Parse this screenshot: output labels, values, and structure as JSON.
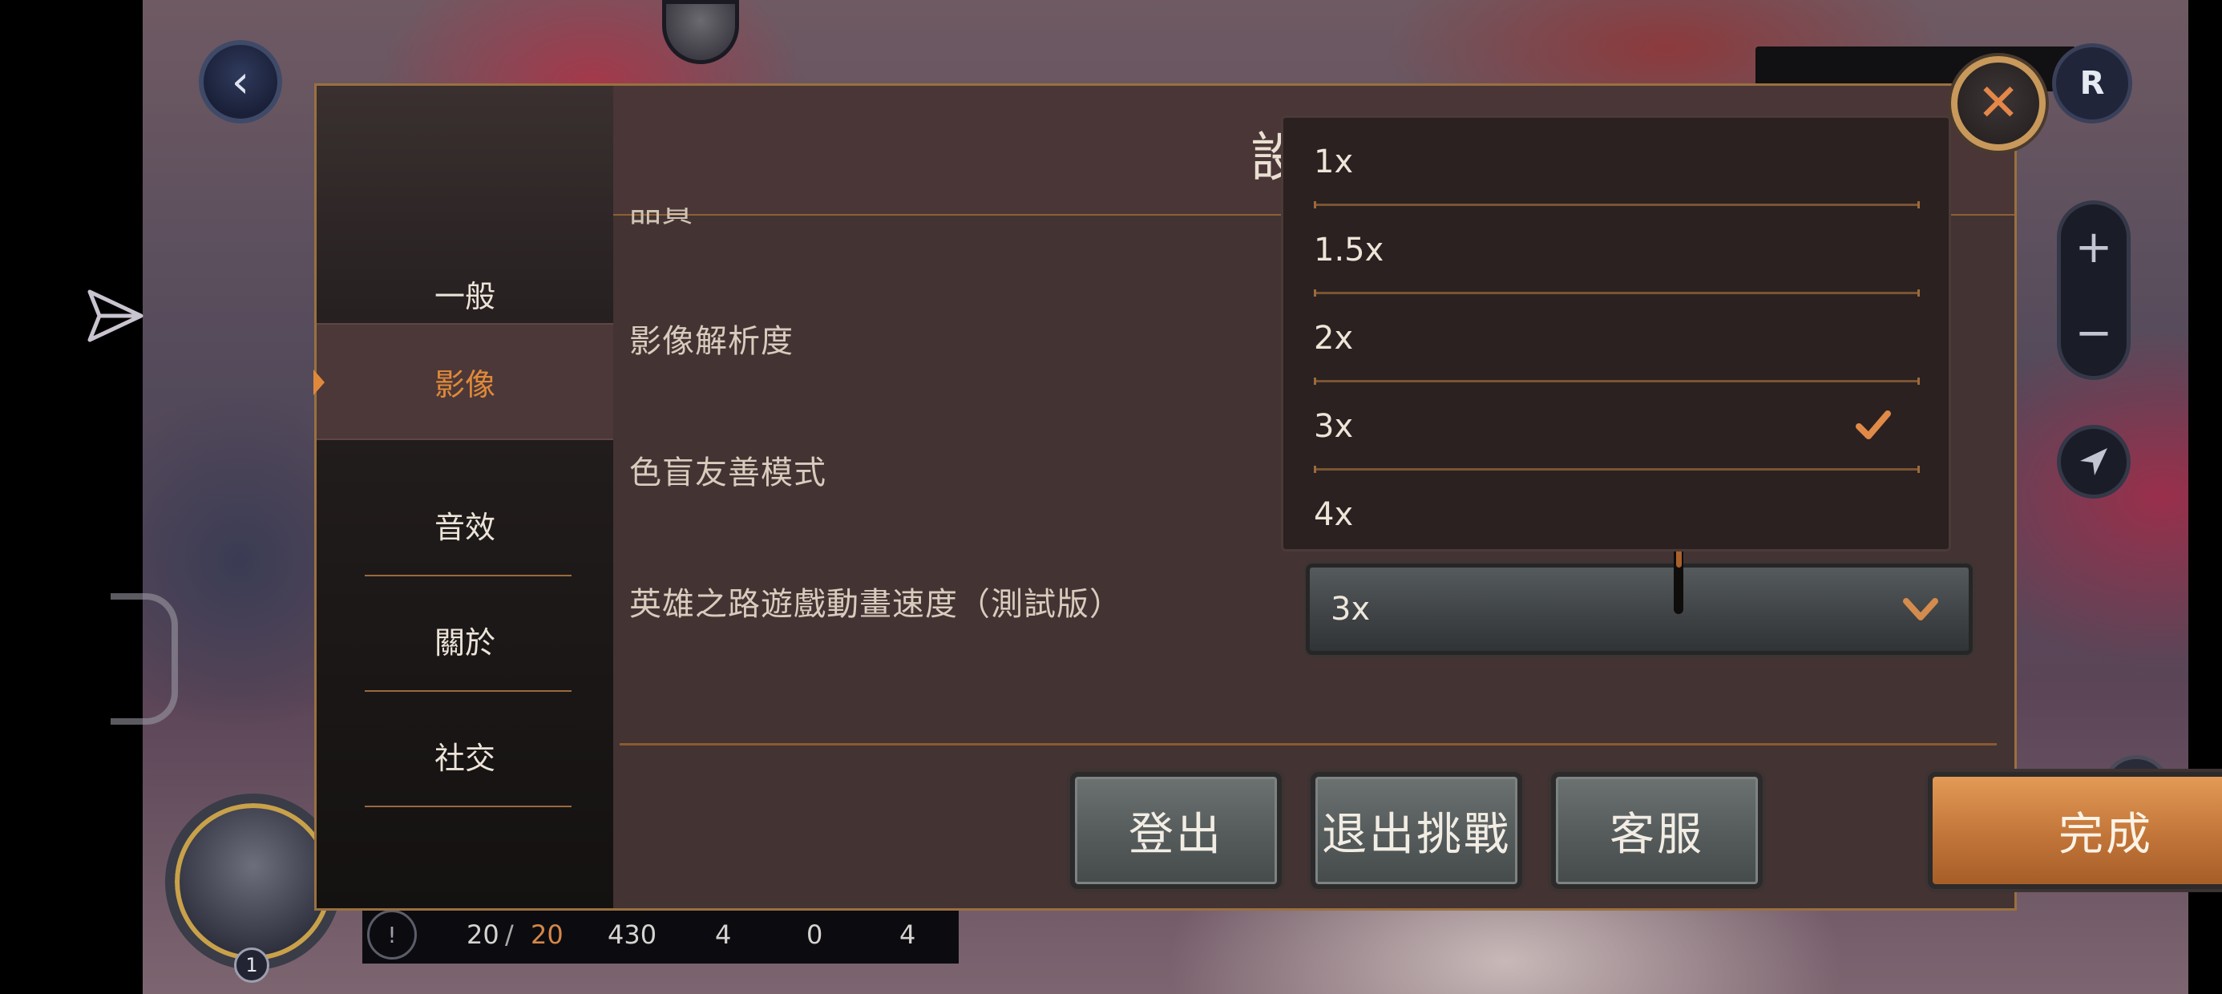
{
  "dialog": {
    "title": "設",
    "cut_off_label": "品質",
    "close_symbol": "✕"
  },
  "sidebar": {
    "items": [
      {
        "label": "一般",
        "active": false
      },
      {
        "label": "影像",
        "active": true
      },
      {
        "label": "音效",
        "active": false
      },
      {
        "label": "關於",
        "active": false
      },
      {
        "label": "社交",
        "active": false
      }
    ]
  },
  "settings": [
    {
      "label": "影像解析度"
    },
    {
      "label": "色盲友善模式"
    },
    {
      "label": "英雄之路遊戲動畫速度（測試版）",
      "value": "3x"
    }
  ],
  "dropdown": {
    "options": [
      "1x",
      "1.5x",
      "2x",
      "3x",
      "4x"
    ],
    "selected": "3x"
  },
  "buttons": {
    "logout": "登出",
    "quit_challenge": "退出挑戰",
    "support": "客服",
    "done": "完成"
  },
  "hud": {
    "hp_current": "20",
    "hp_sep": "/",
    "hp_max": "20",
    "gold": "430",
    "stat_a": "4",
    "stat_b": "0",
    "stat_c": "4",
    "hero_level": "1",
    "zoom_in": "+",
    "zoom_out": "−"
  },
  "colors": {
    "accent": "#e0893a",
    "dialog_bg": "#433333",
    "border_gold": "#9a7040"
  },
  "icons": [
    "back-icon",
    "share-icon",
    "r-logo-icon",
    "zoom-in-icon",
    "zoom-out-icon",
    "navigate-icon",
    "lock-icon",
    "close-icon",
    "check-icon",
    "chevron-down-icon"
  ]
}
